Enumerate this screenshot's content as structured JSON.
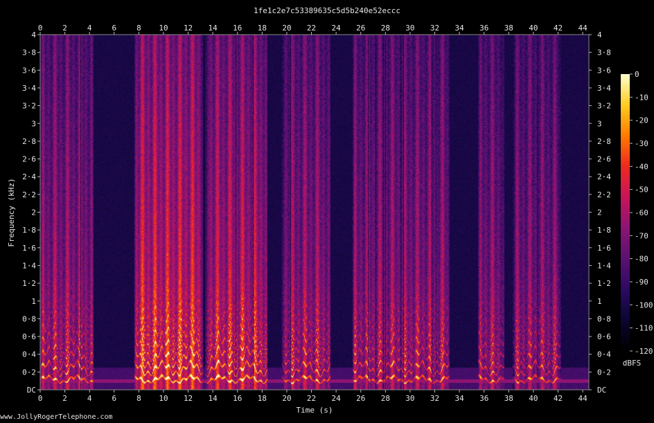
{
  "chart_data": {
    "type": "heatmap",
    "title": "1fe1c2e7c53389635c5d5b240e52eccc",
    "xlabel": "Time (s)",
    "ylabel": "Frequency (kHz)",
    "xlim": [
      0,
      44.5
    ],
    "ylim": [
      0,
      4
    ],
    "x_ticks": [
      0,
      2,
      4,
      6,
      8,
      10,
      12,
      14,
      16,
      18,
      20,
      22,
      24,
      26,
      28,
      30,
      32,
      34,
      36,
      38,
      40,
      42,
      44
    ],
    "y_ticks": [
      {
        "value": 0,
        "label": "DC"
      },
      {
        "value": 0.2,
        "label": "0·2"
      },
      {
        "value": 0.4,
        "label": "0·4"
      },
      {
        "value": 0.6,
        "label": "0·6"
      },
      {
        "value": 0.8,
        "label": "0·8"
      },
      {
        "value": 1.0,
        "label": "1"
      },
      {
        "value": 1.2,
        "label": "1·2"
      },
      {
        "value": 1.4,
        "label": "1·4"
      },
      {
        "value": 1.6,
        "label": "1·6"
      },
      {
        "value": 1.8,
        "label": "1·8"
      },
      {
        "value": 2.0,
        "label": "2"
      },
      {
        "value": 2.2,
        "label": "2·2"
      },
      {
        "value": 2.4,
        "label": "2·4"
      },
      {
        "value": 2.6,
        "label": "2·6"
      },
      {
        "value": 2.8,
        "label": "2·8"
      },
      {
        "value": 3.0,
        "label": "3"
      },
      {
        "value": 3.2,
        "label": "3·2"
      },
      {
        "value": 3.4,
        "label": "3·4"
      },
      {
        "value": 3.6,
        "label": "3·6"
      },
      {
        "value": 3.8,
        "label": "3·8"
      },
      {
        "value": 4.0,
        "label": "4"
      }
    ],
    "colorbar": {
      "unit": "dBFS",
      "range": [
        -120,
        0
      ],
      "ticks": [
        0,
        -10,
        -20,
        -30,
        -40,
        -50,
        -60,
        -70,
        -80,
        -90,
        -100,
        -110,
        -120
      ]
    },
    "speech_segments": [
      {
        "start": 0.0,
        "end": 4.3,
        "level": 0.62
      },
      {
        "start": 7.6,
        "end": 13.2,
        "level": 0.78
      },
      {
        "start": 13.4,
        "end": 18.4,
        "level": 0.72
      },
      {
        "start": 19.6,
        "end": 23.5,
        "level": 0.62
      },
      {
        "start": 25.3,
        "end": 33.2,
        "level": 0.6
      },
      {
        "start": 35.5,
        "end": 37.6,
        "level": 0.58
      },
      {
        "start": 38.3,
        "end": 42.2,
        "level": 0.56
      }
    ],
    "silence_level": 0.18,
    "colormap": [
      "#000000",
      "#0a0630",
      "#2c0a62",
      "#5a1170",
      "#8c1474",
      "#c8145a",
      "#ee2a20",
      "#ff7a00",
      "#ffcc22",
      "#ffffcc"
    ]
  },
  "watermark": "www.JollyRogerTelephone.com"
}
